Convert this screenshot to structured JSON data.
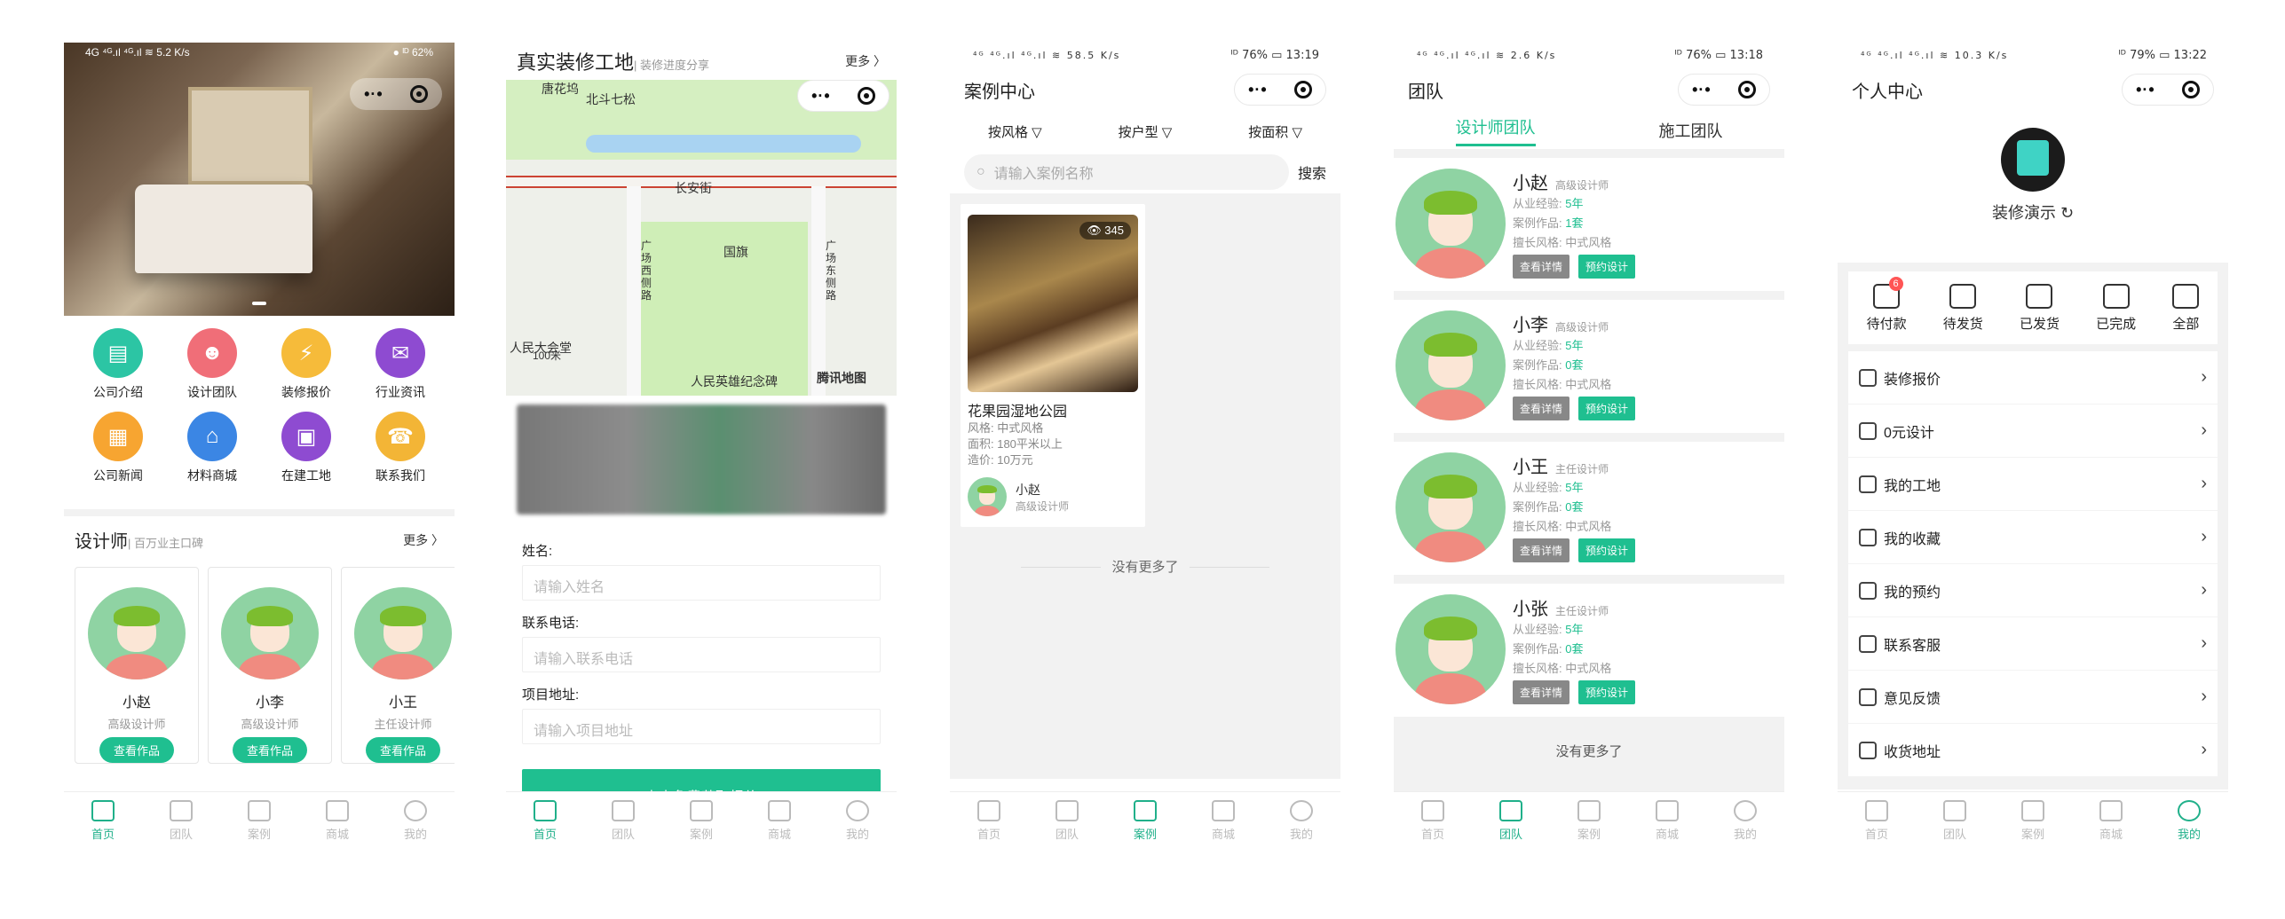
{
  "tabbar": [
    "首页",
    "团队",
    "案例",
    "商城",
    "我的"
  ],
  "capsule": {
    "dots": "•·•"
  },
  "p1": {
    "status_left": "4G ⁴ᴳ.ıl ⁴ᴳ.ıl ≋ 5.2 K/s",
    "status_right": "● ᴵᴰ 62%",
    "grid": [
      {
        "label": "公司介绍",
        "color": "#2cc5a4",
        "icon": "▤"
      },
      {
        "label": "设计团队",
        "color": "#f06e78",
        "icon": "☻"
      },
      {
        "label": "装修报价",
        "color": "#f6bb3a",
        "icon": "⚡"
      },
      {
        "label": "行业资讯",
        "color": "#8e4bd1",
        "icon": "✉"
      },
      {
        "label": "公司新闻",
        "color": "#f7a531",
        "icon": "▦"
      },
      {
        "label": "材料商城",
        "color": "#3b86e4",
        "icon": "⌂"
      },
      {
        "label": "在建工地",
        "color": "#8e4bd1",
        "icon": "▣"
      },
      {
        "label": "联系我们",
        "color": "#f3b536",
        "icon": "☎"
      }
    ],
    "section_title": "设计师",
    "section_sub": "| 百万业主口碑",
    "more": "更多 〉",
    "designers": [
      {
        "name": "小赵",
        "role": "高级设计师",
        "btn": "查看作品"
      },
      {
        "name": "小李",
        "role": "高级设计师",
        "btn": "查看作品"
      },
      {
        "name": "小王",
        "role": "主任设计师",
        "btn": "查看作品"
      }
    ]
  },
  "p2": {
    "title": "真实装修工地",
    "sub": "| 装修进度分享",
    "more": "更多 〉",
    "map_labels": {
      "a": "唐花坞",
      "b": "北斗七松",
      "c": "长安街",
      "d": "国旗",
      "e": "人民大会堂",
      "f": "100米",
      "g": "人民英雄纪念碑",
      "h": "腾讯地图",
      "i": "广场西侧路",
      "j": "广场东侧路"
    },
    "fields": [
      {
        "label": "姓名:",
        "placeholder": "请输入姓名"
      },
      {
        "label": "联系电话:",
        "placeholder": "请输入联系电话"
      },
      {
        "label": "项目地址:",
        "placeholder": "请输入项目地址"
      }
    ],
    "submit": "点击免费获取报价"
  },
  "p3": {
    "status_left": "⁴ᴳ ⁴ᴳ.ıl ⁴ᴳ.ıl ≋ 58.5 K/s",
    "status_right": "ᴵᴰ 76% ▭ 13:19",
    "title": "案例中心",
    "filters": [
      "按风格 ▽",
      "按户型 ▽",
      "按面积 ▽"
    ],
    "search_placeholder": "请输入案例名称",
    "search_btn": "搜索",
    "case": {
      "views": "👁 345",
      "name": "花果园湿地公园",
      "style": "风格:   中式风格",
      "area": "面积:   180平米以上",
      "cost": "造价:   10万元",
      "author": "小赵",
      "author_role": "高级设计师"
    },
    "nomore": "没有更多了"
  },
  "p4": {
    "status_left": "⁴ᴳ ⁴ᴳ.ıl ⁴ᴳ.ıl ≋ 2.6 K/s",
    "status_right": "ᴵᴰ 76% ▭ 13:18",
    "title": "团队",
    "tabs": [
      "设计师团队",
      "施工团队"
    ],
    "k_exp": "从业经验: ",
    "k_works": "案例作品: ",
    "k_style": "擅长风格: ",
    "btn_detail": "查看详情",
    "btn_book": "预约设计",
    "members": [
      {
        "name": "小赵",
        "role": "高级设计师",
        "exp": "5年",
        "works": "1套",
        "style": "中式风格"
      },
      {
        "name": "小李",
        "role": "高级设计师",
        "exp": "5年",
        "works": "0套",
        "style": "中式风格"
      },
      {
        "name": "小王",
        "role": "主任设计师",
        "exp": "5年",
        "works": "0套",
        "style": "中式风格"
      },
      {
        "name": "小张",
        "role": "主任设计师",
        "exp": "5年",
        "works": "0套",
        "style": "中式风格"
      }
    ],
    "nomore": "没有更多了"
  },
  "p5": {
    "status_left": "⁴ᴳ ⁴ᴳ.ıl ⁴ᴳ.ıl ≋ 10.3 K/s",
    "status_right": "ᴵᴰ 79% ▭ 13:22",
    "title": "个人中心",
    "profile_name": "装修演示 ↻",
    "orders": [
      {
        "label": "待付款",
        "badge": "6"
      },
      {
        "label": "待发货",
        "badge": ""
      },
      {
        "label": "已发货",
        "badge": ""
      },
      {
        "label": "已完成",
        "badge": ""
      },
      {
        "label": "全部",
        "badge": ""
      }
    ],
    "menu": [
      "装修报价",
      "0元设计",
      "我的工地",
      "我的收藏",
      "我的预约",
      "联系客服",
      "意见反馈",
      "收货地址"
    ]
  }
}
